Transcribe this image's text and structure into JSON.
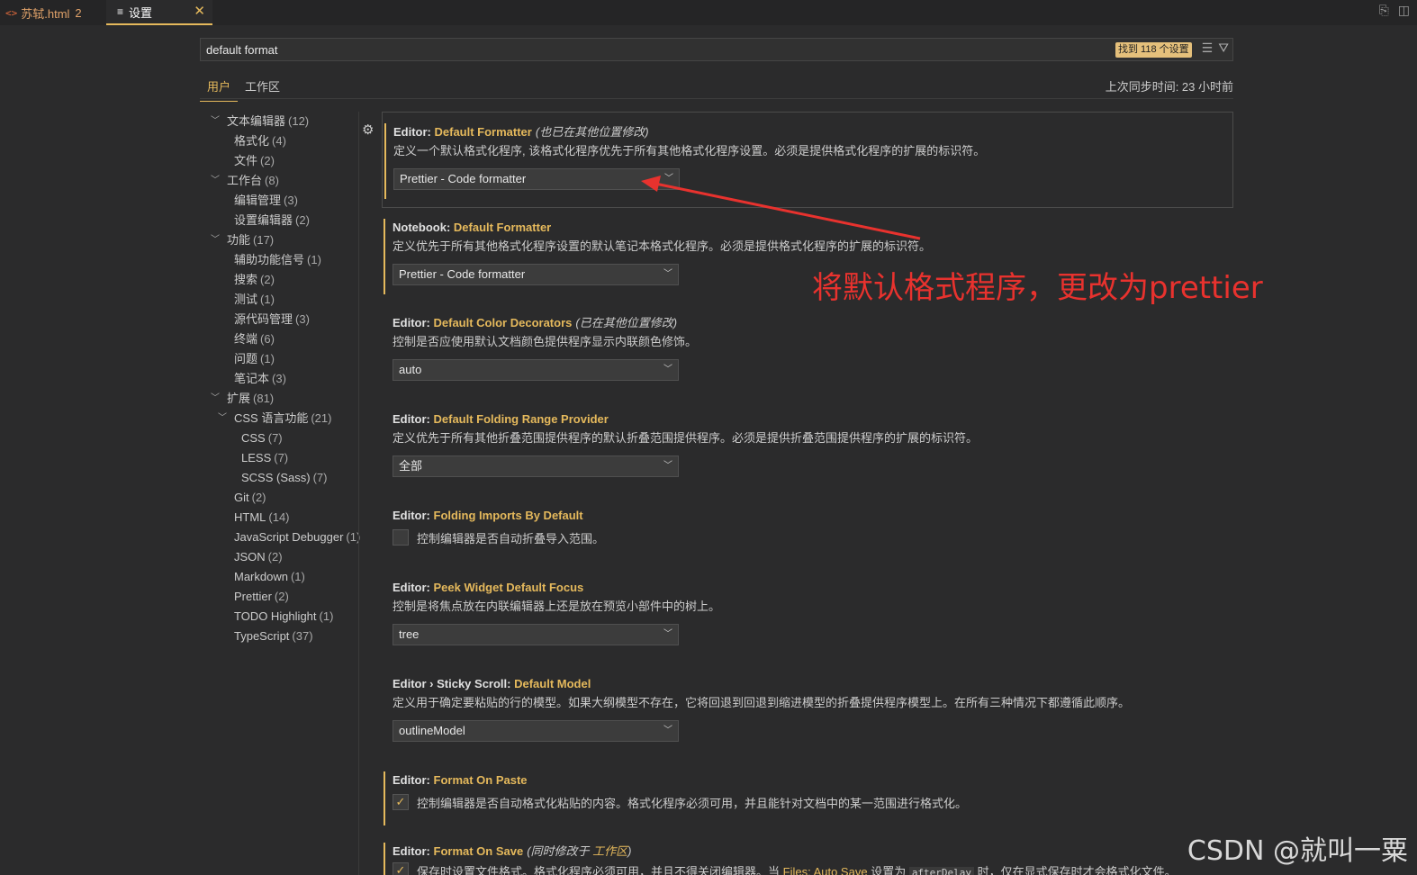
{
  "tabs": [
    {
      "label": "苏轼.html",
      "badge": "2"
    },
    {
      "label": "设置",
      "close": "✕"
    }
  ],
  "search": {
    "value": "default format",
    "results_badge": "找到 118 个设置"
  },
  "scope_tabs": [
    "用户",
    "工作区"
  ],
  "sync_status": "上次同步时间: 23 小时前",
  "toc": [
    {
      "label": "文本编辑器",
      "count": "(12)",
      "level": 0,
      "expanded": true
    },
    {
      "label": "格式化",
      "count": "(4)",
      "level": 1
    },
    {
      "label": "文件",
      "count": "(2)",
      "level": 1
    },
    {
      "label": "工作台",
      "count": "(8)",
      "level": 0,
      "expanded": true
    },
    {
      "label": "编辑管理",
      "count": "(3)",
      "level": 1
    },
    {
      "label": "设置编辑器",
      "count": "(2)",
      "level": 1
    },
    {
      "label": "功能",
      "count": "(17)",
      "level": 0,
      "expanded": true
    },
    {
      "label": "辅助功能信号",
      "count": "(1)",
      "level": 1
    },
    {
      "label": "搜索",
      "count": "(2)",
      "level": 1
    },
    {
      "label": "测试",
      "count": "(1)",
      "level": 1
    },
    {
      "label": "源代码管理",
      "count": "(3)",
      "level": 1
    },
    {
      "label": "终端",
      "count": "(6)",
      "level": 1
    },
    {
      "label": "问题",
      "count": "(1)",
      "level": 1
    },
    {
      "label": "笔记本",
      "count": "(3)",
      "level": 1
    },
    {
      "label": "扩展",
      "count": "(81)",
      "level": 0,
      "expanded": true
    },
    {
      "label": "CSS 语言功能",
      "count": "(21)",
      "level": 1,
      "expanded": true
    },
    {
      "label": "CSS",
      "count": "(7)",
      "level": 2
    },
    {
      "label": "LESS",
      "count": "(7)",
      "level": 2
    },
    {
      "label": "SCSS (Sass)",
      "count": "(7)",
      "level": 2
    },
    {
      "label": "Git",
      "count": "(2)",
      "level": 1
    },
    {
      "label": "HTML",
      "count": "(14)",
      "level": 1
    },
    {
      "label": "JavaScript Debugger",
      "count": "(1)",
      "level": 1
    },
    {
      "label": "JSON",
      "count": "(2)",
      "level": 1
    },
    {
      "label": "Markdown",
      "count": "(1)",
      "level": 1
    },
    {
      "label": "Prettier",
      "count": "(2)",
      "level": 1
    },
    {
      "label": "TODO Highlight",
      "count": "(1)",
      "level": 1
    },
    {
      "label": "TypeScript",
      "count": "(37)",
      "level": 1
    }
  ],
  "settings": [
    {
      "category": "Editor: ",
      "name": "Default Formatter",
      "note": "(也已在其他位置修改)",
      "desc": "定义一个默认格式化程序, 该格式化程序优先于所有其他格式化程序设置。必须是提供格式化程序的扩展的标识符。",
      "value": "Prettier - Code formatter"
    },
    {
      "category": "Notebook: ",
      "name": "Default Formatter",
      "desc": "定义优先于所有其他格式化程序设置的默认笔记本格式化程序。必须是提供格式化程序的扩展的标识符。",
      "value": "Prettier - Code formatter"
    },
    {
      "category": "Editor: ",
      "name": "Default Color Decorators",
      "note": "(已在其他位置修改)",
      "desc": "控制是否应使用默认文档颜色提供程序显示内联颜色修饰。",
      "value": "auto"
    },
    {
      "category": "Editor: ",
      "name": "Default Folding Range Provider",
      "desc": "定义优先于所有其他折叠范围提供程序的默认折叠范围提供程序。必须是提供折叠范围提供程序的扩展的标识符。",
      "value": "全部"
    },
    {
      "category": "Editor: ",
      "name": "Folding Imports By Default",
      "desc": "控制编辑器是否自动折叠导入范围。",
      "checked": false
    },
    {
      "category": "Editor: ",
      "name": "Peek Widget Default Focus",
      "desc": "控制是将焦点放在内联编辑器上还是放在预览小部件中的树上。",
      "value": "tree"
    },
    {
      "category": "Editor › Sticky Scroll: ",
      "name": "Default Model",
      "desc": "定义用于确定要粘贴的行的模型。如果大纲模型不存在，它将回退到回退到缩进模型的折叠提供程序模型上。在所有三种情况下都遵循此顺序。",
      "value": "outlineModel"
    },
    {
      "category": "Editor: ",
      "name": "Format On Paste",
      "desc": "控制编辑器是否自动格式化粘贴的内容。格式化程序必须可用，并且能针对文档中的某一范围进行格式化。",
      "checked": true
    },
    {
      "category": "Editor: ",
      "name": "Format On Save",
      "note": "(同时修改于 ",
      "note_link": "工作区",
      "note_end": ")",
      "desc_a": "保存时设置文件格式。格式化程序必须可用，并且不得关闭编辑器。当 ",
      "desc_link": "Files: Auto Save",
      "desc_b": " 设置为 ",
      "desc_code": "afterDelay",
      "desc_c": " 时，仅在显式保存时才会格式化文件。",
      "checked": true
    }
  ],
  "annotation": "将默认格式程序，更改为prettier",
  "watermark": "CSDN @就叫一粟",
  "colors": {
    "accent": "#e5b95c",
    "annotation": "#e8322e",
    "background": "#2b2b2c"
  }
}
